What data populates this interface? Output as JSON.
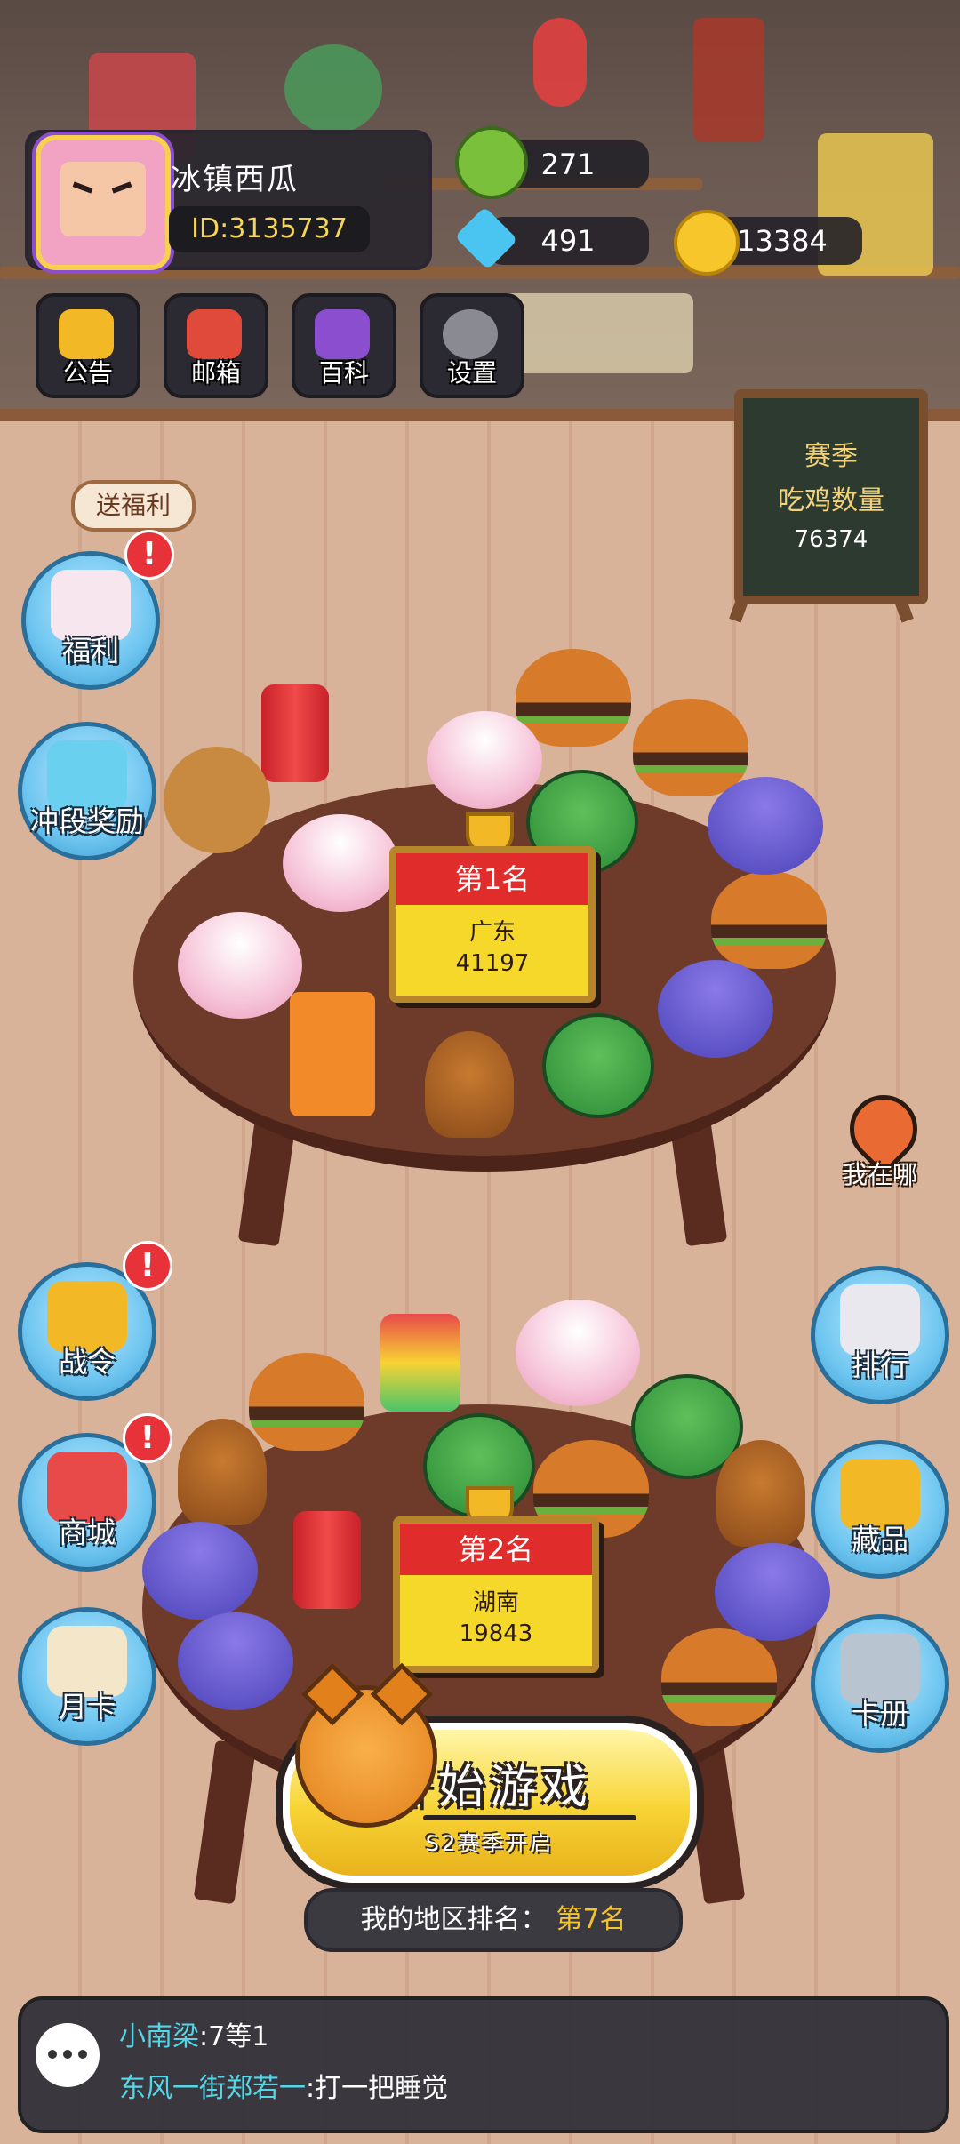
{
  "player": {
    "nickname": "冰镇西瓜",
    "id": "ID:3135737"
  },
  "currency": {
    "frog": "271",
    "diamond": "491",
    "coin": "13384"
  },
  "top_menu": [
    {
      "label": "公告",
      "icon": "bell-icon"
    },
    {
      "label": "邮箱",
      "icon": "mailbox-icon"
    },
    {
      "label": "百科",
      "icon": "encyclopedia-icon"
    },
    {
      "label": "设置",
      "icon": "gear-icon"
    }
  ],
  "board": {
    "line1": "赛季",
    "line2": "吃鸡数量",
    "count": "76374"
  },
  "left_menu": {
    "welfare_tag": "送福利",
    "items": [
      {
        "label": "福利",
        "alert": "!"
      },
      {
        "label": "冲段奖励",
        "alert": ""
      },
      {
        "label": "战令",
        "alert": "!"
      },
      {
        "label": "商城",
        "alert": "!"
      },
      {
        "label": "月卡",
        "alert": ""
      }
    ]
  },
  "right_menu": {
    "locate": "我在哪",
    "items": [
      {
        "label": "排行"
      },
      {
        "label": "藏品"
      },
      {
        "label": "卡册"
      }
    ]
  },
  "tables": [
    {
      "rank": "第1名",
      "region": "广东",
      "score": "41197"
    },
    {
      "rank": "第2名",
      "region": "湖南",
      "score": "19843"
    }
  ],
  "start": {
    "label": "开始游戏",
    "sub": "S2赛季开启"
  },
  "my_rank": {
    "label": "我的地区排名：",
    "value": "第7名"
  },
  "chat": [
    {
      "user": "小南梁",
      "text": ":7等1"
    },
    {
      "user": "东风一街郑若一",
      "text": ":打一把睡觉"
    }
  ],
  "colors": {
    "accent_yellow": "#f7d334",
    "rank_red": "#e02c2a",
    "side_button_blue": "#6fc6f0",
    "floor": "#d9b29a"
  }
}
